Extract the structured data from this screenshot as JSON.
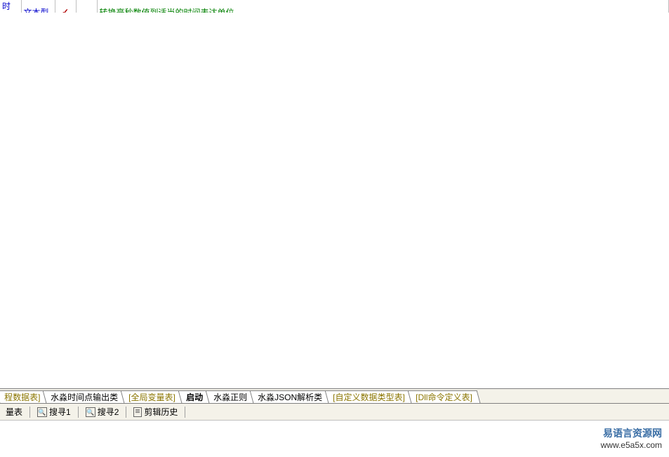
{
  "table": {
    "rows": [
      {
        "name": "时间",
        "type": "文本型",
        "checked": true,
        "desc": "转换毫秒数值到适当的时间表达单位"
      }
    ]
  },
  "tabs": [
    {
      "label": "程数据表]",
      "bracket": true,
      "active": false
    },
    {
      "label": "水淼时间点输出类",
      "bracket": false,
      "active": false
    },
    {
      "label": "[全局变量表]",
      "bracket": true,
      "active": false
    },
    {
      "label": "启动",
      "bracket": false,
      "active": true
    },
    {
      "label": "水淼正则",
      "bracket": false,
      "active": false
    },
    {
      "label": "水淼JSON解析类",
      "bracket": false,
      "active": false
    },
    {
      "label": "[自定义数据类型表]",
      "bracket": true,
      "active": false
    },
    {
      "label": "[Dll命令定义表]",
      "bracket": true,
      "active": false
    }
  ],
  "toolbar": {
    "item1": "量表",
    "search1": "搜寻1",
    "search2": "搜寻2",
    "history": "剪辑历史"
  },
  "watermark": {
    "title": "易语言资源网",
    "url": "www.e5a5x.com"
  },
  "checkmark_glyph": "✓"
}
